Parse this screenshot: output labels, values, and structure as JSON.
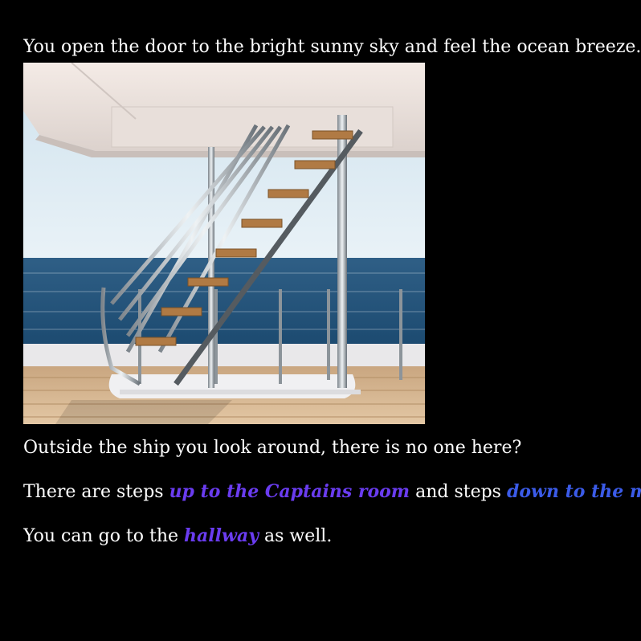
{
  "passage": {
    "intro": "You open the door to the bright sunny sky and feel the ocean breeze.",
    "image": {
      "icon": "ship-deck-staircase-image",
      "alt": "Ship deck with a steel staircase over the ocean"
    },
    "outside": "Outside the ship you look around, there is no one here?",
    "steps_prefix": "There are steps ",
    "link_up": "up to the Captains room",
    "steps_middle": " and steps ",
    "link_down": "down to the ma",
    "hallway_prefix": "You can go to the ",
    "link_hallway": "hallway",
    "hallway_suffix": " as well."
  },
  "colors": {
    "background": "#000000",
    "text": "#ffffff",
    "link_primary": "#6a3cf0",
    "link_secondary": "#3b5be8"
  }
}
